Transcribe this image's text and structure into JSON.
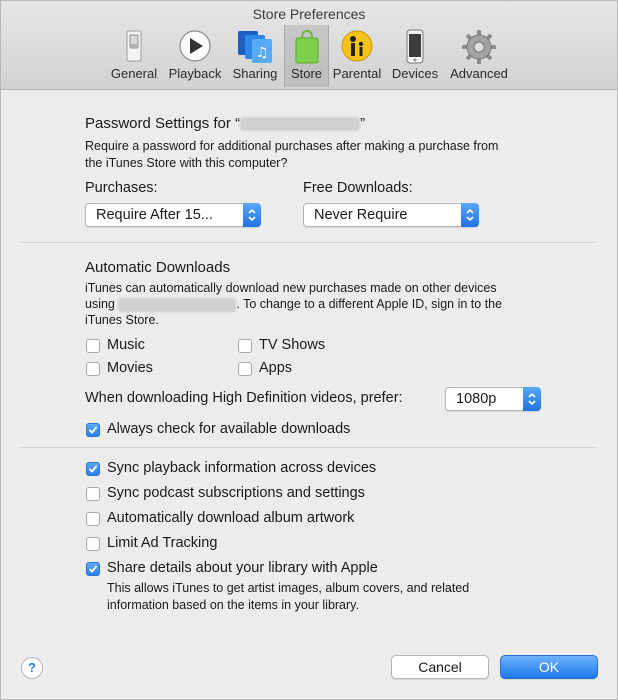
{
  "window": {
    "title": "Store Preferences"
  },
  "toolbar": {
    "items": [
      {
        "label": "General"
      },
      {
        "label": "Playback"
      },
      {
        "label": "Sharing"
      },
      {
        "label": "Store"
      },
      {
        "label": "Parental"
      },
      {
        "label": "Devices"
      },
      {
        "label": "Advanced"
      }
    ],
    "selected": "Store"
  },
  "password_settings": {
    "heading_prefix": "Password Settings for “",
    "heading_suffix": "”",
    "description": [
      "Require a password for additional purchases after making a purchase from",
      "the iTunes Store with this computer?"
    ],
    "purchases_label": "Purchases:",
    "purchases_value": "Require After 15...",
    "free_downloads_label": "Free Downloads:",
    "free_downloads_value": "Never Require"
  },
  "automatic_downloads": {
    "heading": "Automatic Downloads",
    "line1": "iTunes can automatically download new purchases made on other devices",
    "line2_prefix": "using",
    "line2_suffix": ". To change to a different Apple ID, sign in to the",
    "line3": "iTunes Store.",
    "options": [
      {
        "label": "Music",
        "checked": false
      },
      {
        "label": "TV Shows",
        "checked": false
      },
      {
        "label": "Movies",
        "checked": false
      },
      {
        "label": "Apps",
        "checked": false
      }
    ],
    "hd_label": "When downloading High Definition videos, prefer:",
    "hd_value": "1080p",
    "always_check_label": "Always check for available downloads",
    "always_check_checked": true
  },
  "sync_options": [
    {
      "label": "Sync playback information across devices",
      "checked": true
    },
    {
      "label": "Sync podcast subscriptions and settings",
      "checked": false
    },
    {
      "label": "Automatically download album artwork",
      "checked": false
    },
    {
      "label": "Limit Ad Tracking",
      "checked": false
    },
    {
      "label": "Share details about your library with Apple",
      "checked": true
    }
  ],
  "share_description": [
    "This allows iTunes to get artist images, album covers, and related",
    "information based on the items in your library."
  ],
  "footer": {
    "help": "?",
    "cancel": "Cancel",
    "ok": "OK"
  },
  "colors": {
    "accent": "#2a7ee8",
    "window_bg": "#ececec"
  },
  "icons": [
    "switch-icon",
    "play-icon",
    "sharing-icon",
    "store-bag-icon",
    "parental-icon",
    "devices-icon",
    "gear-icon",
    "checkmark-icon",
    "popup-arrows-icon"
  ]
}
